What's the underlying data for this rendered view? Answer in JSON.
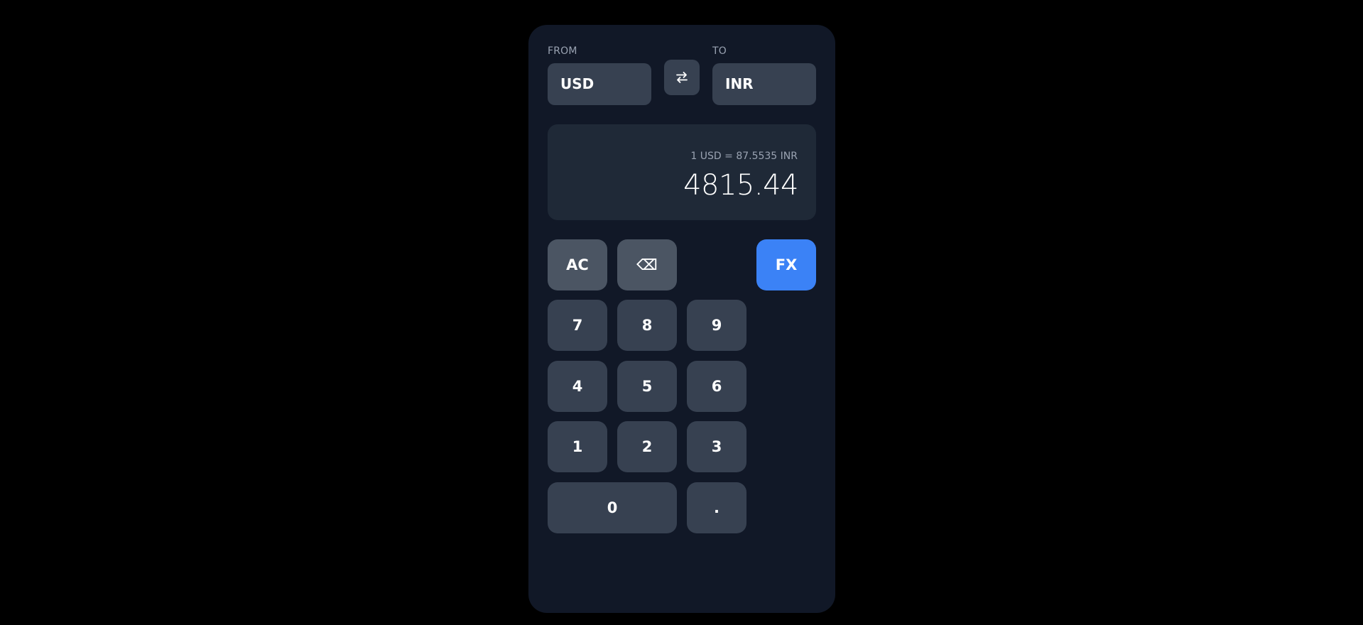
{
  "converter": {
    "from_label": "FROM",
    "to_label": "TO",
    "from_currency": "USD",
    "to_currency": "INR",
    "swap_icon": "swap-arrows-icon"
  },
  "display": {
    "rate_text": "1 USD = 87.5535 INR",
    "value": "4815.44"
  },
  "keypad": {
    "clear": "AC",
    "backspace": "⌫",
    "fx": "FX",
    "k7": "7",
    "k8": "8",
    "k9": "9",
    "k4": "4",
    "k5": "5",
    "k6": "6",
    "k1": "1",
    "k2": "2",
    "k3": "3",
    "k0": "0",
    "decimal": "."
  },
  "colors": {
    "background": "#000000",
    "panel": "#111827",
    "display": "#1f2937",
    "key": "#374151",
    "function_key": "#4b5563",
    "accent": "#3b82f6"
  }
}
